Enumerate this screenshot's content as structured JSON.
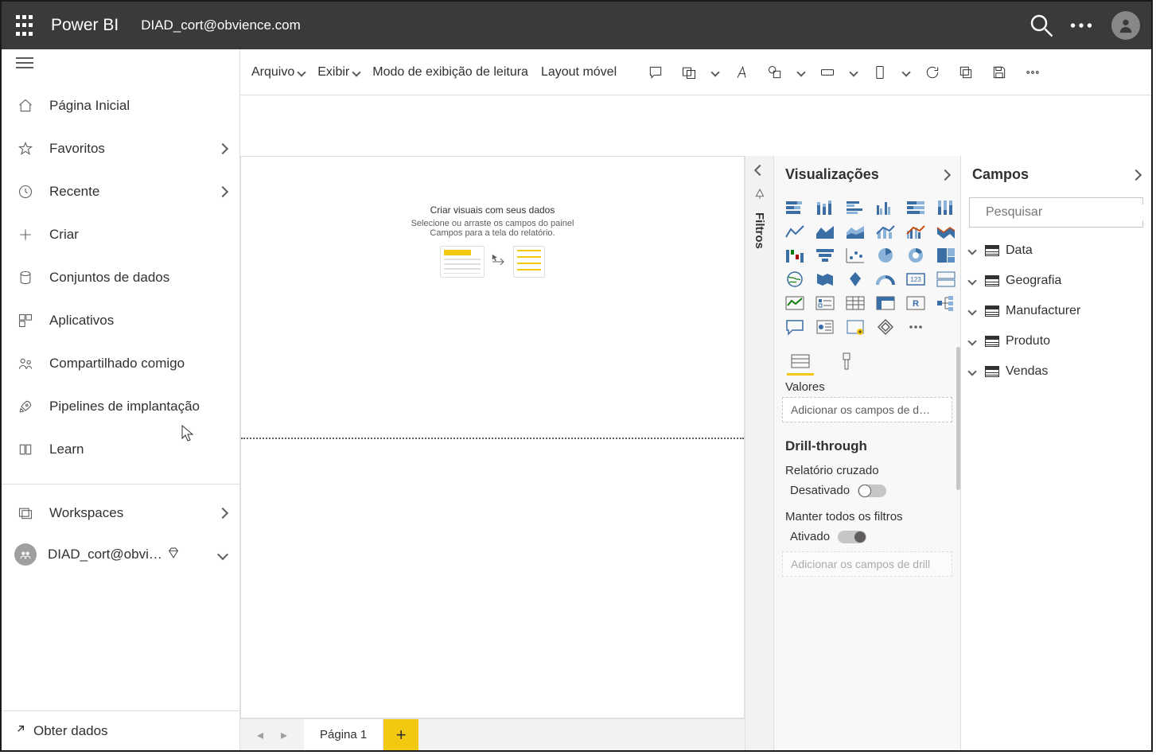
{
  "header": {
    "brand": "Power BI",
    "persona": "DIAD_cort@obvience.com"
  },
  "sidebar": {
    "items": [
      {
        "label": "Página Inicial",
        "chevron": false
      },
      {
        "label": "Favoritos",
        "chevron": true
      },
      {
        "label": "Recente",
        "chevron": true
      },
      {
        "label": "Criar",
        "chevron": false
      },
      {
        "label": "Conjuntos de dados",
        "chevron": false
      },
      {
        "label": "Aplicativos",
        "chevron": false
      },
      {
        "label": "Compartilhado comigo",
        "chevron": false
      },
      {
        "label": "Pipelines de implantação",
        "chevron": false
      },
      {
        "label": "Learn",
        "chevron": false
      }
    ],
    "workspaces_label": "Workspaces",
    "current_workspace": "DIAD_cort@obvi…",
    "get_data": "Obter dados"
  },
  "ribbon": {
    "file": "Arquivo",
    "view": "Exibir",
    "reading_mode": "Modo de exibição de leitura",
    "mobile_layout": "Layout móvel"
  },
  "canvas": {
    "title": "Criar visuais com seus dados",
    "line1": "Selecione ou arraste os campos do painel",
    "line2": "Campos para a tela do relatório."
  },
  "tabs": {
    "page1": "Página 1"
  },
  "filters": {
    "label": "Filtros"
  },
  "viz": {
    "title": "Visualizações",
    "values": "Valores",
    "add_fields": "Adicionar os campos de d…",
    "drillthrough": "Drill-through",
    "cross_report": "Relatório cruzado",
    "off": "Desativado",
    "keep_filters": "Manter todos os filtros",
    "on": "Ativado",
    "add_drill": "Adicionar os campos de drill"
  },
  "fields": {
    "title": "Campos",
    "search_placeholder": "Pesquisar",
    "tables": [
      "Data",
      "Geografia",
      "Manufacturer",
      "Produto",
      "Vendas"
    ]
  }
}
